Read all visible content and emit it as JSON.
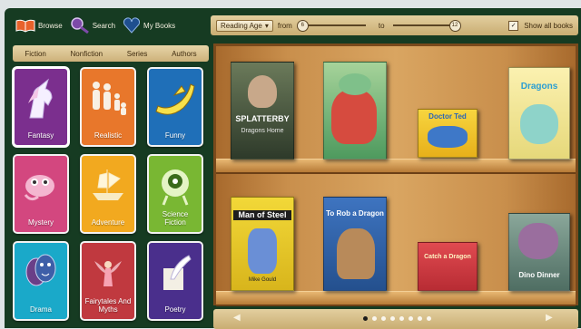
{
  "nav": {
    "browse": "Browse",
    "search": "Search",
    "mybooks": "My Books"
  },
  "filter": {
    "reading_age_label": "Reading Age",
    "from_label": "from",
    "to_label": "to",
    "from_value": "6",
    "to_value": "12",
    "show_all_label": "Show all books",
    "show_all_checked": true
  },
  "categories": [
    "Fiction",
    "Nonfiction",
    "Series",
    "Authors"
  ],
  "genres": [
    {
      "label": "Fantasy",
      "color": "#7b2f8e",
      "icon": "unicorn-icon"
    },
    {
      "label": "Realistic",
      "color": "#e8772b",
      "icon": "family-icon"
    },
    {
      "label": "Funny",
      "color": "#1f6fb8",
      "icon": "banana-icon"
    },
    {
      "label": "Mystery",
      "color": "#d3477f",
      "icon": "mystery-creature-icon"
    },
    {
      "label": "Adventure",
      "color": "#f2a91f",
      "icon": "ship-icon"
    },
    {
      "label": "Science Fiction",
      "color": "#79b733",
      "icon": "alien-icon"
    },
    {
      "label": "Drama",
      "color": "#1aa9c9",
      "icon": "masks-icon"
    },
    {
      "label": "Fairytales And Myths",
      "color": "#c0393f",
      "icon": "fairy-icon"
    },
    {
      "label": "Poetry",
      "color": "#4a2f8c",
      "icon": "quill-icon"
    }
  ],
  "books_top": [
    {
      "title": "SPLATTERBY",
      "subtitle": "Dragons Home",
      "color": "#3a4a32"
    },
    {
      "title": "",
      "subtitle": "",
      "color": "#5aa56c"
    },
    {
      "title": "Doctor Ted",
      "subtitle": "",
      "color": "#f1c52b"
    },
    {
      "title": "Dragons",
      "subtitle": "",
      "color": "#f4e18a"
    }
  ],
  "books_bottom": [
    {
      "title": "Man of Steel",
      "subtitle": "Mike Gould",
      "color": "#e2c224"
    },
    {
      "title": "To Rob a Dragon",
      "subtitle": "",
      "color": "#3b6bb3"
    },
    {
      "title": "Catch a Dragon",
      "subtitle": "",
      "color": "#d83a45"
    },
    {
      "title": "Dino Dinner",
      "subtitle": "",
      "color": "#6e8d83"
    }
  ],
  "pager": {
    "prev": "◀",
    "next": "▶",
    "pages": 8,
    "current": 1
  }
}
